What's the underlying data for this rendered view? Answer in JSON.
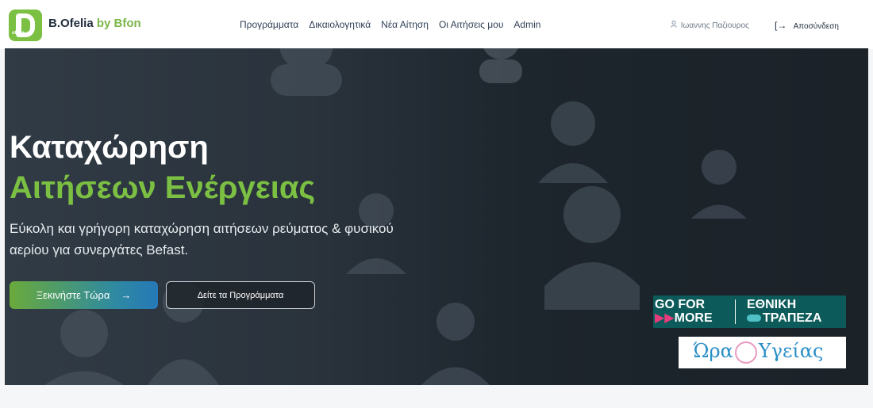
{
  "brand": {
    "logo_text": "ofelia",
    "name": "B.Ofelia",
    "suffix": "by Bfon",
    "accent_color": "#7bc043"
  },
  "nav": {
    "links": [
      {
        "label": "Προγράμματα"
      },
      {
        "label": "Δικαιολογητικά"
      },
      {
        "label": "Νέα Αίτηση"
      },
      {
        "label": "Οι Αιτήσεις μου"
      },
      {
        "label": "Admin"
      }
    ],
    "user_name": "Ιωαννης Παζιουρος",
    "logout_label": "Αποσύνδεση"
  },
  "hero": {
    "title_line1": "Καταχώρηση",
    "title_line2": "Αιτήσεων Ενέργειας",
    "subtitle": "Εύκολη και γρήγορη καταχώρηση αιτήσεων ρεύματος & φυσικού αερίου για συνεργάτες Befast.",
    "primary_button": "Ξεκινήστε Τώρα",
    "secondary_button": "Δείτε τα Προγράμματα"
  },
  "badges": {
    "gofor_line1": "GO FOR",
    "gofor_line2": "MORE",
    "bank_line1": "ΕΘΝΙΚΗ",
    "bank_line2": "ΤΡΑΠΕΖΑ",
    "ora_part1": "Ώρα",
    "ora_part2": "Υγείας"
  },
  "icons": {
    "user": "user-icon",
    "logout": "logout-arrow-icon",
    "arrow": "arrow-right-icon"
  }
}
